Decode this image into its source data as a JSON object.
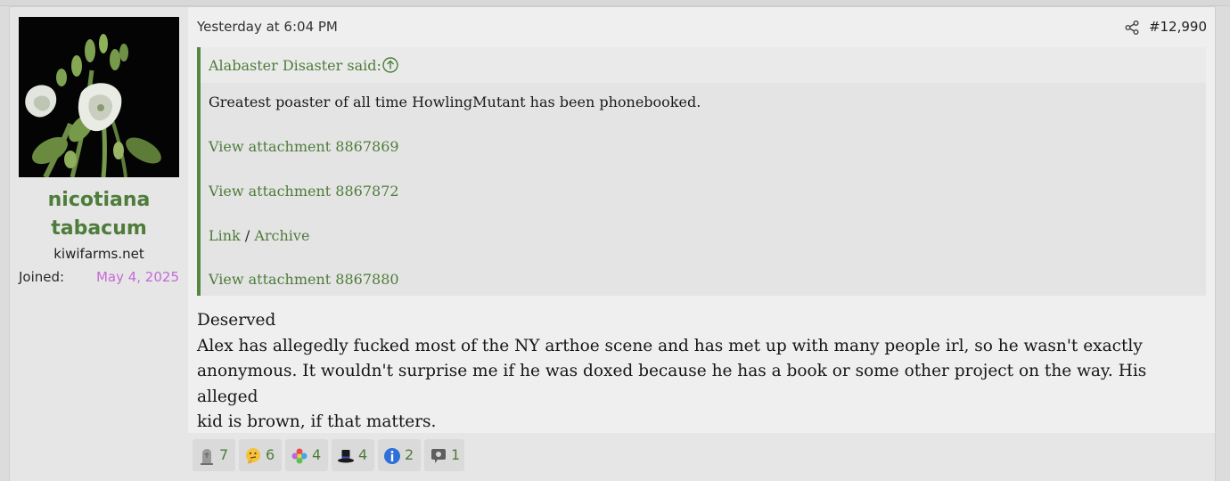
{
  "user": {
    "name_line1": "nicotiana",
    "name_line2": "tabacum",
    "title": "kiwifarms.net",
    "joined_label": "Joined:",
    "joined_date": "May 4, 2025"
  },
  "post": {
    "date": "Yesterday at 6:04 PM",
    "number": "#12,990",
    "share_icon": "share-icon"
  },
  "quote": {
    "author_said": "Alabaster Disaster said:",
    "expand_icon": "arrow-up-circle-icon",
    "text": "Greatest poaster of all time HowlingMutant has been phonebooked.",
    "attachment1": "View attachment 8867869",
    "attachment2": "View attachment 8867872",
    "link": "Link",
    "separator": "/",
    "archive": "Archive",
    "attachment3": "View attachment 8867880"
  },
  "message": {
    "line1": "Deserved",
    "line2": "Alex has allegedly fucked most of the NY arthoe scene and has met up with many people irl, so he wasn't exactly",
    "line3": "anonymous. It wouldn't surprise me if he was doxed because he has a book or some other project on the way. His alleged",
    "line4": "kid is brown, if that matters."
  },
  "reactions": [
    {
      "icon": "gravestone-icon",
      "count": "7"
    },
    {
      "icon": "thinking-face-icon",
      "count": "6"
    },
    {
      "icon": "colorful-flower-icon",
      "count": "4"
    },
    {
      "icon": "top-hat-icon",
      "count": "4"
    },
    {
      "icon": "informative-i-icon",
      "count": "2"
    },
    {
      "icon": "speech-bubble-icon",
      "count": "1"
    }
  ],
  "colors": {
    "accent_green": "#4e7c3a",
    "joined_date": "#c46bd8"
  }
}
